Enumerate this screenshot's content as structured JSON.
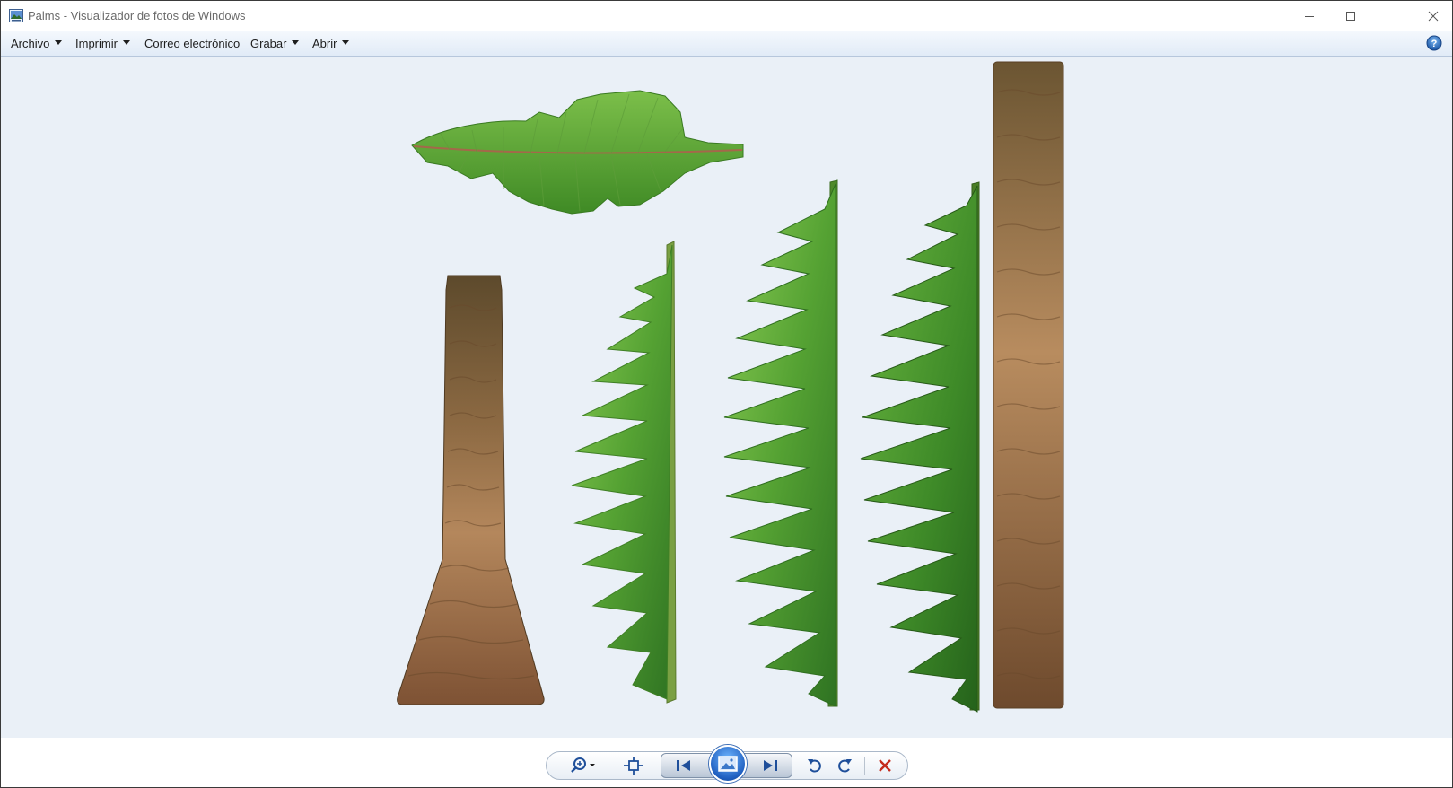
{
  "window": {
    "title": "Palms - Visualizador de fotos de Windows",
    "icon": "photo-viewer-app-icon"
  },
  "titlebar_buttons": [
    "minimize-icon",
    "maximize-icon",
    "close-icon"
  ],
  "menu": {
    "items": [
      {
        "label": "Archivo",
        "dropdown": true
      },
      {
        "label": "Imprimir",
        "dropdown": true
      },
      {
        "label": "Correo electrónico",
        "dropdown": false
      },
      {
        "label": "Grabar",
        "dropdown": true
      },
      {
        "label": "Abrir",
        "dropdown": true
      }
    ],
    "help_icon": "help-icon"
  },
  "image": {
    "subject": "palm tree sprite parts: banana leaf, tapered trunk, three fern fronds, tall straight trunk",
    "background_color": "#eaf0f7"
  },
  "controls": {
    "buttons": [
      "zoom-icon",
      "actual-size-icon",
      "previous-icon",
      "slideshow-icon",
      "next-icon",
      "rotate-counterclockwise-icon",
      "rotate-clockwise-icon",
      "delete-icon"
    ]
  },
  "colors": {
    "accent": "#1f5fc0",
    "delete": "#c42b1c",
    "leaf_green": "#4e9a2c",
    "trunk_brown": "#9a6a43"
  }
}
